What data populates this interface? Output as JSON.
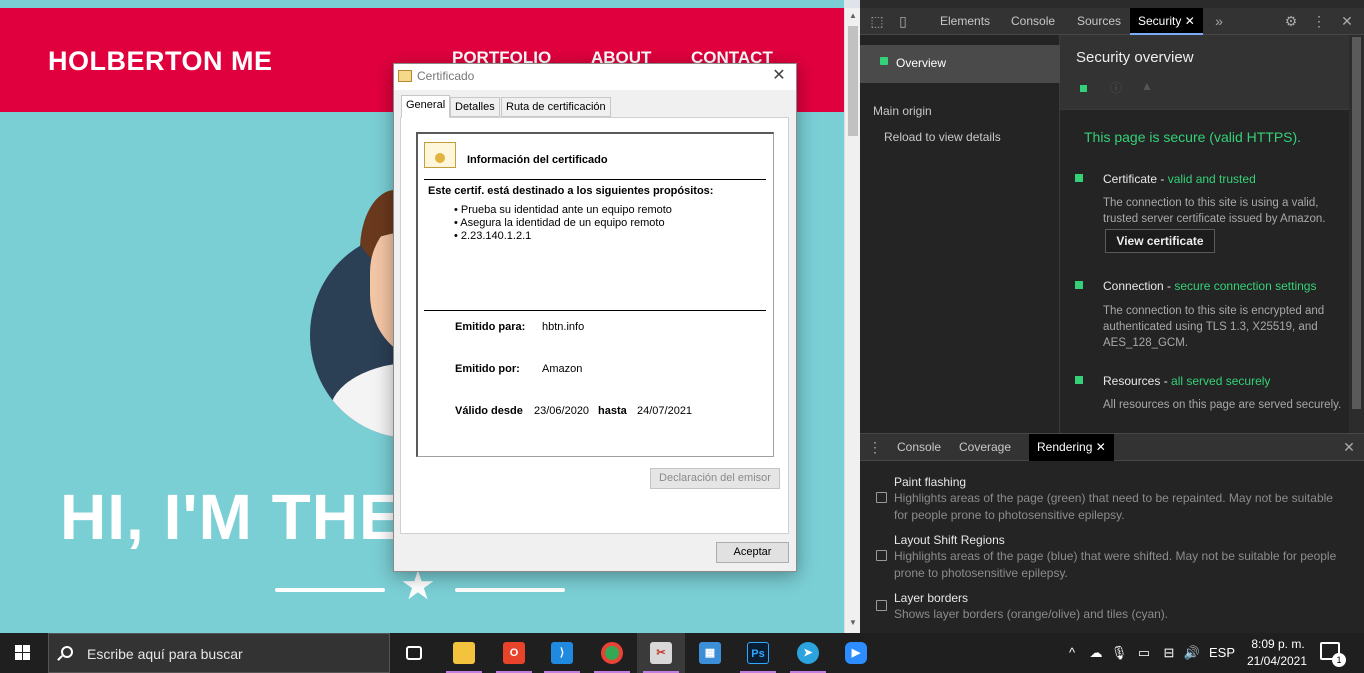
{
  "site": {
    "brand": "HOLBERTON ME",
    "nav": [
      "PORTFOLIO",
      "ABOUT",
      "CONTACT"
    ],
    "hero_title": "HI, I'M THE"
  },
  "cert_dialog": {
    "title": "Certificado",
    "tabs": [
      "General",
      "Detalles",
      "Ruta de certificación"
    ],
    "info_title": "Información del certificado",
    "purpose_heading": "Este certif. está destinado a los siguientes propósitos:",
    "purposes": [
      "• Prueba su identidad ante un equipo remoto",
      "• Asegura la identidad de un equipo remoto",
      "• 2.23.140.1.2.1"
    ],
    "issued_to_label": "Emitido para:",
    "issued_to": "hbtn.info",
    "issued_by_label": "Emitido por:",
    "issued_by": "Amazon",
    "valid_from_label": "Válido desde",
    "valid_from": "23/06/2020",
    "valid_to_label": "hasta",
    "valid_to": "24/07/2021",
    "issuer_statement_button": "Declaración del emisor",
    "accept_button": "Aceptar",
    "close_glyph": "✕"
  },
  "devtools": {
    "tabs": [
      "Elements",
      "Console",
      "Sources",
      "Security"
    ],
    "active_tab": "Security",
    "more_glyph": "»",
    "sidebar": {
      "overview": "Overview",
      "main_origin": "Main origin",
      "reload": "Reload to view details"
    },
    "security": {
      "title": "Security overview",
      "secure_message": "This page is secure (valid HTTPS).",
      "certificate_label": "Certificate - ",
      "certificate_status": "valid and trusted",
      "certificate_desc": "The connection to this site is using a valid, trusted server certificate issued by Amazon.",
      "view_certificate": "View certificate",
      "connection_label": "Connection - ",
      "connection_status": "secure connection settings",
      "connection_desc": "The connection to this site is encrypted and authenticated using TLS 1.3, X25519, and AES_128_GCM.",
      "resources_label": "Resources - ",
      "resources_status": "all served securely",
      "resources_desc": "All resources on this page are served securely."
    },
    "drawer": {
      "tabs": [
        "Console",
        "Coverage",
        "Rendering"
      ],
      "active_tab": "Rendering",
      "options": [
        {
          "title": "Paint flashing",
          "desc": "Highlights areas of the page (green) that need to be repainted. May not be suitable for people prone to photosensitive epilepsy."
        },
        {
          "title": "Layout Shift Regions",
          "desc": "Highlights areas of the page (blue) that were shifted. May not be suitable for people prone to photosensitive epilepsy."
        },
        {
          "title": "Layer borders",
          "desc": "Shows layer borders (orange/olive) and tiles (cyan)."
        }
      ]
    }
  },
  "taskbar": {
    "search_placeholder": "Escribe aquí para buscar",
    "language": "ESP",
    "time": "8:09 p. m.",
    "date": "21/04/2021",
    "notification_count": "1",
    "apps": [
      "task-view",
      "file-explorer",
      "office",
      "vscode",
      "chrome",
      "snipping-tool",
      "control-panel",
      "photoshop",
      "telegram",
      "zoom"
    ]
  },
  "colors": {
    "site_header": "#e1003e",
    "site_bg": "#7acfd5",
    "secure_green": "#34d178",
    "devtools_bg": "#242424",
    "taskbar_bg": "#1f1f1f"
  }
}
